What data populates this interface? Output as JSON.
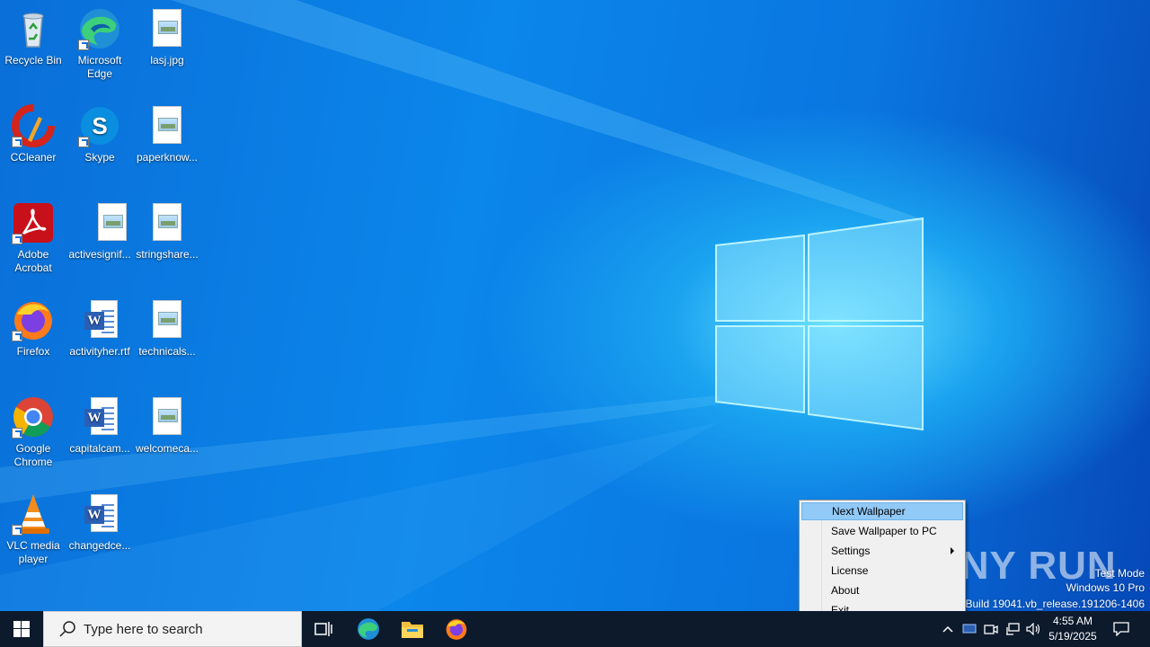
{
  "desktop": {
    "icons": [
      {
        "label": "Recycle Bin",
        "icon": "recycle-bin-icon"
      },
      {
        "label": "Microsoft Edge",
        "icon": "edge-icon"
      },
      {
        "label": "lasj.jpg",
        "icon": "image-file-icon"
      },
      {
        "label": "CCleaner",
        "icon": "ccleaner-icon"
      },
      {
        "label": "Skype",
        "icon": "skype-icon"
      },
      {
        "label": "paperknow...",
        "icon": "image-file-icon"
      },
      {
        "label": "Adobe Acrobat",
        "icon": "acrobat-icon"
      },
      {
        "label": "activesignif...",
        "icon": "image-file-icon"
      },
      {
        "label": "stringshare...",
        "icon": "image-file-icon"
      },
      {
        "label": "Firefox",
        "icon": "firefox-icon"
      },
      {
        "label": "activityher.rtf",
        "icon": "word-document-icon"
      },
      {
        "label": "technicals...",
        "icon": "image-file-icon"
      },
      {
        "label": "Google Chrome",
        "icon": "chrome-icon"
      },
      {
        "label": "capitalcam...",
        "icon": "word-document-icon"
      },
      {
        "label": "welcomeca...",
        "icon": "image-file-icon"
      },
      {
        "label": "VLC media player",
        "icon": "vlc-icon"
      },
      {
        "label": "changedce...",
        "icon": "word-document-icon"
      }
    ]
  },
  "context_menu": {
    "items": [
      {
        "label": "Next Wallpaper"
      },
      {
        "label": "Save Wallpaper to PC"
      },
      {
        "label": "Settings"
      },
      {
        "label": "License"
      },
      {
        "label": "About"
      },
      {
        "label": "Exit"
      }
    ]
  },
  "watermark": {
    "logo_text": "ANY RUN",
    "line1": "Test Mode",
    "line2": "Windows 10 Pro",
    "line3": "Build 19041.vb_release.191206-1406"
  },
  "taskbar": {
    "search_placeholder": "Type here to search",
    "time": "4:55 AM",
    "date": "5/19/2025"
  }
}
